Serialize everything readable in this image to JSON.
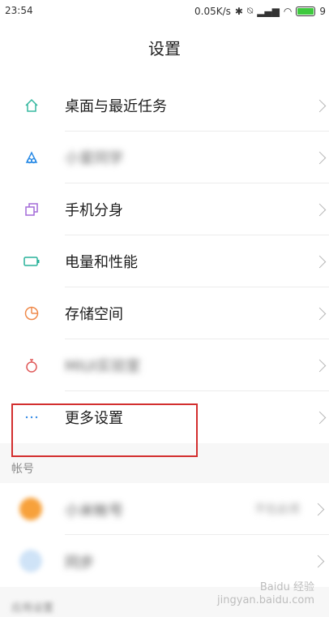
{
  "status_bar": {
    "time": "23:54",
    "net_speed": "0.05K/s",
    "battery_level": "9"
  },
  "header": {
    "title": "设置"
  },
  "items": [
    {
      "label": "桌面与最近任务",
      "icon": "home-icon",
      "color": "#36b8a0",
      "blurred": false
    },
    {
      "label": "小爱同学",
      "icon": "xiaoai-icon",
      "color": "#2a8be6",
      "blurred": true
    },
    {
      "label": "手机分身",
      "icon": "clone-icon",
      "color": "#a46bd8",
      "blurred": false
    },
    {
      "label": "电量和性能",
      "icon": "battery-icon",
      "color": "#28b29a",
      "blurred": false
    },
    {
      "label": "存储空间",
      "icon": "pie-icon",
      "color": "#ef8a4b",
      "blurred": false
    },
    {
      "label": "MIUI实验室",
      "icon": "flask-icon",
      "color": "#e05a5a",
      "blurred": true
    },
    {
      "label": "更多设置",
      "icon": "more-icon",
      "color": "#3a8ee6",
      "blurred": false
    }
  ],
  "account": {
    "section_title": "帐号",
    "items": [
      {
        "label": "小米帐号",
        "value": "不在此项",
        "icon_color": "#f7a13b"
      },
      {
        "label": "同步",
        "value": "",
        "icon_color": "#63a9ec"
      }
    ]
  },
  "section2_title": "应用设置",
  "watermark": {
    "line1": "Baidu 经验",
    "line2": "jingyan.baidu.com"
  }
}
